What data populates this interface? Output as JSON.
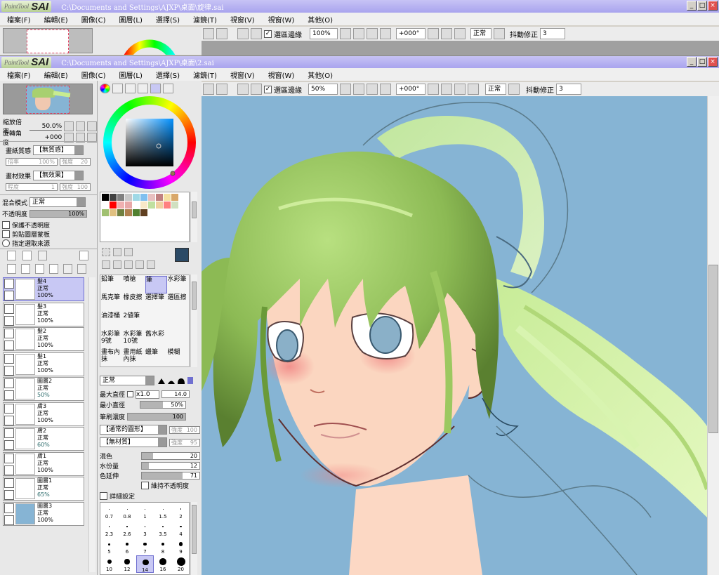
{
  "back_window": {
    "app_logo_text": "PaintTool",
    "app_logo_sai": "SAI",
    "title": "C:\\Documents and Settings\\AJXP\\桌面\\旋律.sai",
    "menu": [
      "檔案(F)",
      "編輯(E)",
      "圖像(C)",
      "圖層(L)",
      "選擇(S)",
      "濾鏡(T)",
      "視窗(V)",
      "視窗(W)",
      "其他(O)"
    ],
    "zoom": "100%",
    "angle": "+000°",
    "blend": "正常",
    "stabilizer_label": "抖動修正",
    "stabilizer_value": "3",
    "selection_edge_label": "選區邊緣"
  },
  "window": {
    "app_logo_text": "PaintTool",
    "app_logo_sai": "SAI",
    "title": "C:\\Documents and Settings\\AJXP\\桌面\\2.sai",
    "menu": [
      "檔案(F)",
      "編輯(E)",
      "圖像(C)",
      "圖層(L)",
      "選擇(S)",
      "濾鏡(T)",
      "視窗(V)",
      "視窗(W)",
      "其他(O)"
    ],
    "win_min": "_",
    "win_max": "□",
    "win_close": "×"
  },
  "toolbar": {
    "selection_edge_label": "選區邊緣",
    "zoom": "50%",
    "angle": "+000°",
    "blend": "正常",
    "stabilizer_label": "抖動修正",
    "stabilizer_value": "3"
  },
  "navigator": {
    "zoom_label": "縮放倍率",
    "zoom_value": "50.0%",
    "angle_label": "旋轉角度",
    "angle_value": "+000"
  },
  "paper": {
    "texture_label": "畫紙質感",
    "texture_value": "【無質感】",
    "scale_label": "倍率",
    "scale_value": "100%",
    "strength_label": "強度",
    "strength_value": "20",
    "effect_label": "畫材效果",
    "effect_value": "【無效果】",
    "degree_label": "程度",
    "degree_value": "1",
    "strength2_label": "強度",
    "strength2_value": "100"
  },
  "layer_props": {
    "blend_label": "混合模式",
    "blend_value": "正常",
    "opacity_label": "不透明度",
    "opacity_value": "100%",
    "opacity_fraction": 1.0,
    "opt1": "保護不透明度",
    "opt2": "剪貼圖層蒙板",
    "opt3": "指定選取來源"
  },
  "layers": [
    {
      "name": "髮4",
      "mode": "正常",
      "opacity": "100%",
      "selected": true,
      "tint": false,
      "thumb": "#ffffff"
    },
    {
      "name": "髮3",
      "mode": "正常",
      "opacity": "100%",
      "selected": false,
      "tint": false,
      "thumb": "#ffffff"
    },
    {
      "name": "髮2",
      "mode": "正常",
      "opacity": "100%",
      "selected": false,
      "tint": false,
      "thumb": "#ffffff"
    },
    {
      "name": "髮1",
      "mode": "正常",
      "opacity": "100%",
      "selected": false,
      "tint": false,
      "thumb": "#ffffff"
    },
    {
      "name": "圖層2",
      "mode": "正常",
      "opacity": "50%",
      "selected": false,
      "tint": true,
      "thumb": "#ffffff"
    },
    {
      "name": "膚3",
      "mode": "正常",
      "opacity": "100%",
      "selected": false,
      "tint": false,
      "thumb": "#ffffff"
    },
    {
      "name": "膚2",
      "mode": "正常",
      "opacity": "60%",
      "selected": false,
      "tint": true,
      "thumb": "#ffffff"
    },
    {
      "name": "膚1",
      "mode": "正常",
      "opacity": "100%",
      "selected": false,
      "tint": false,
      "thumb": "#ffffff"
    },
    {
      "name": "圖層1",
      "mode": "正常",
      "opacity": "65%",
      "selected": false,
      "tint": true,
      "thumb": "#ffffff"
    },
    {
      "name": "圖層3",
      "mode": "正常",
      "opacity": "100%",
      "selected": false,
      "tint": false,
      "thumb": "#86b4d4"
    }
  ],
  "colors": {
    "primary": "#2b4a66",
    "secondary": "#ffffff",
    "canvas_bg": "#86b4d4",
    "title_bar": "#a9a4ee"
  },
  "swatches": [
    "#000000",
    "#404040",
    "#808080",
    "#c8c8c8",
    "#9fd9e6",
    "#7fbfef",
    "#e8c0c0",
    "#c08080",
    "#f4e0a0",
    "#d9a86a",
    "#ffffff",
    "#ff0000",
    "#f0b0b0",
    "#e8a8a8",
    "#ffffff",
    "#f8e8c8",
    "#c0e0a0",
    "#f0d0a0",
    "#ff8080",
    "#d0e0c0",
    "#a0c070",
    "#e0c080",
    "#708040",
    "#b08050",
    "#508030",
    "#604020"
  ],
  "tools_section": {
    "tools": [
      {
        "label": "鉛筆",
        "selected": false
      },
      {
        "label": "噴槍",
        "selected": false
      },
      {
        "label": "筆",
        "selected": true
      },
      {
        "label": "水彩筆",
        "selected": false
      },
      {
        "label": "馬克筆",
        "selected": false
      },
      {
        "label": "橡皮擦",
        "selected": false
      },
      {
        "label": "選擇筆",
        "selected": false
      },
      {
        "label": "選區擦",
        "selected": false
      },
      {
        "label": "油漆桶",
        "selected": false
      },
      {
        "label": "2値筆",
        "selected": false
      },
      {
        "label": "",
        "selected": false
      },
      {
        "label": "",
        "selected": false
      },
      {
        "label": "水彩筆9號",
        "selected": false
      },
      {
        "label": "水彩筆10號",
        "selected": false
      },
      {
        "label": "舊水彩",
        "selected": false
      },
      {
        "label": "",
        "selected": false
      },
      {
        "label": "畫布內抹",
        "selected": false
      },
      {
        "label": "畫用紙內抹",
        "selected": false
      },
      {
        "label": "蠟筆",
        "selected": false
      },
      {
        "label": "模糊",
        "selected": false
      }
    ]
  },
  "brush": {
    "mode": "正常",
    "max_size_label": "最大直徑",
    "max_size_mult": "x1.0",
    "max_size_value": "14.0",
    "min_size_label": "最小直徑",
    "min_size_value": "50%",
    "min_size_fraction": 0.5,
    "density_label": "筆刷濃度",
    "density_value": "100",
    "density_fraction": 1.0,
    "shape": "【通常的圓形】",
    "shape_strength_label": "強度",
    "shape_strength": "100",
    "texture": "【無材質】",
    "texture_strength_label": "強度",
    "texture_strength": "95",
    "blend_label": "混色",
    "blend_value": "20",
    "blend_fraction": 0.2,
    "water_label": "水份量",
    "water_value": "12",
    "water_fraction": 0.12,
    "persist_label": "色延伸",
    "persist_value": "71",
    "persist_fraction": 0.71,
    "keep_opacity": "維持不透明度",
    "detail": "詳細設定",
    "sizes": [
      "0.7",
      "0.8",
      "1",
      "1.5",
      "2",
      "2.3",
      "2.6",
      "3",
      "3.5",
      "4",
      "5",
      "6",
      "7",
      "8",
      "9",
      "10",
      "12",
      "14",
      "16",
      "20"
    ]
  }
}
